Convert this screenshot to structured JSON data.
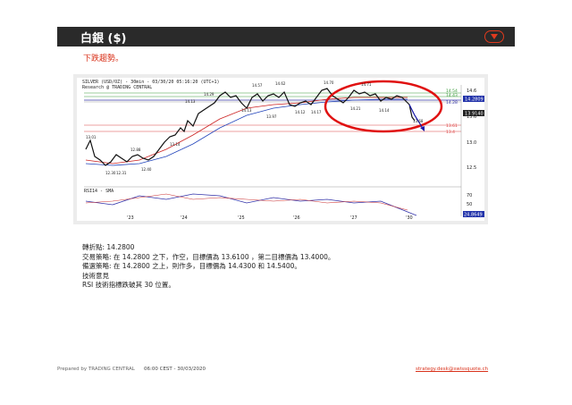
{
  "header": {
    "title": "白銀 ($)",
    "menu_icon": "chevron-down-icon"
  },
  "trend_label": "下跌趨勢。",
  "chart": {
    "title_line1": "SILVER (USD/OZ) - 30min - 03/30/20 05:16:20 (UTC+1)",
    "title_line2": "Research @ TRADING CENTRAL",
    "price_axis": [
      "14.6",
      "14.2809",
      "14.1",
      "13.6",
      "13.0",
      "12.5"
    ],
    "price_badge_current": "14.2809",
    "price_badge_2": "13.9140",
    "level_labels": [
      "14.54",
      "14.43",
      "14.28",
      "13.61",
      "13.4"
    ],
    "point_labels": [
      "13.01",
      "12.88",
      "12.40",
      "12.31",
      "12.30",
      "13.14",
      "14.13",
      "14.29",
      "14.57",
      "14.62",
      "14.70",
      "14.71",
      "14.13",
      "13.97",
      "14.12",
      "14.17",
      "14.21",
      "14.14",
      "13.68"
    ],
    "x_labels": [
      "'23",
      "'24",
      "'25",
      "'26",
      "'27",
      "'30"
    ],
    "rsi_title": "RSI14 - SMA",
    "rsi_axis": [
      "70",
      "50",
      "30"
    ],
    "rsi_badge": "24.8649",
    "colors": {
      "annotation": "#e01010",
      "arrow": "#1a1aaa",
      "ma_red": "#cc2222",
      "ma_blue": "#2244bb"
    }
  },
  "body": {
    "pivot": "轉折點:  14.2800",
    "strategy": "交易策略: 在     14.2800 之下，作空，目標價為  13.6100 ，第二目標價為 13.4000。",
    "alternative": "備選策略: 在     14.2800 之上，則作多，目標價為  14.4300 和 14.5400。",
    "comment_title": "技術意見",
    "comment": "RSI 技術指標跌破其  30 位置。"
  },
  "footer": {
    "left": "Prepared by TRADING CENTRAL",
    "time": "06:00 CEST - 30/03/2020",
    "email": "strategy.desk@swissquote.ch"
  }
}
